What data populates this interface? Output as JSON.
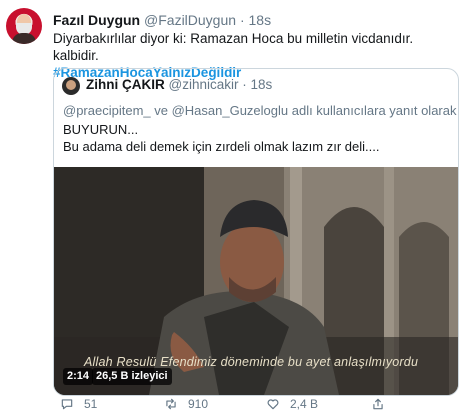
{
  "tweet": {
    "author_name": "Fazıl Duygun",
    "author_handle": "@FazilDuygun",
    "separator": "·",
    "time": "18s",
    "text": "Diyarbakırlılar diyor ki: Ramazan Hoca bu milletin vicdanıdır. kalbidir.",
    "hashtag": "#RamazanHocaYalnızDeğildir"
  },
  "quote": {
    "author_name": "Zihni ÇAKIR",
    "author_handle": "@zihnicakir",
    "separator": "·",
    "time": "18s",
    "replying_to": "@praecipitem_ ve @Hasan_Guzeloglu adlı kullanıcılara yanıt olarak",
    "line1": "BUYURUN...",
    "line2": "Bu adama deli demek için zırdeli olmak lazım zır deli....",
    "video": {
      "caption": "Allah Resulü Efendimiz döneminde bu ayet anlaşılmıyordu",
      "duration": "2:14",
      "views": "26,5 B izleyici"
    }
  },
  "actions": {
    "reply_count": "51",
    "retweet_count": "910",
    "like_count": "2,4 B",
    "icons": [
      "reply-icon",
      "retweet-icon",
      "like-icon",
      "share-icon"
    ]
  },
  "colors": {
    "link": "#1b95e0",
    "secondary_text": "#657786",
    "border": "#ccd6dd"
  }
}
